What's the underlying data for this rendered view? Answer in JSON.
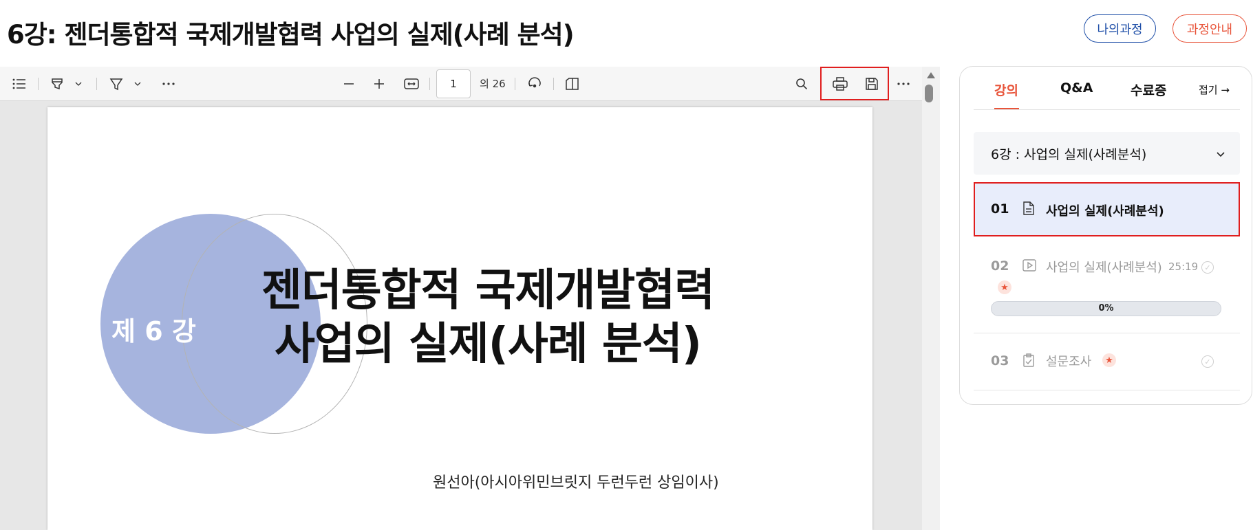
{
  "header": {
    "title": "6강: 젠더통합적 국제개발협력 사업의 실제(사례 분석)",
    "my_course_label": "나의과정",
    "course_guide_label": "과정안내",
    "colors": {
      "primary": "#1f4fa8",
      "accent": "#e8543a",
      "highlight": "#e01e1e"
    }
  },
  "viewer": {
    "toolbar": {
      "icons": [
        "list-icon",
        "highlighter-icon",
        "chevron-down-icon",
        "draw-icon",
        "chevron-down-icon",
        "more-icon",
        "zoom-out-icon",
        "zoom-in-icon",
        "fit-width-icon",
        "rotate-icon",
        "page-view-icon",
        "search-icon",
        "print-icon",
        "save-icon",
        "more-icon"
      ],
      "page_current": "1",
      "page_total_label": "의 26"
    },
    "slide": {
      "lecture_number": "제 6 강",
      "title_line1": "젠더통합적 국제개발협력",
      "title_line2": "사업의 실제(사례 분석)",
      "author": "원선아(아시아위민브릿지 두런두런 상임이사)"
    }
  },
  "panel": {
    "tabs": [
      {
        "label": "강의",
        "active": true
      },
      {
        "label": "Q&A",
        "active": false
      },
      {
        "label": "수료증",
        "active": false
      }
    ],
    "fold_label": "접기 →",
    "chapter_label": "6강 : 사업의 실제(사례분석)",
    "items": [
      {
        "number": "01",
        "icon": "document-icon",
        "title": "사업의 실제(사례분석)",
        "active": true
      },
      {
        "number": "02",
        "icon": "video-icon",
        "title": "사업의 실제(사례분석)",
        "duration": "25:19",
        "progress_label": "0%",
        "progress": 0
      },
      {
        "number": "03",
        "icon": "clipboard-icon",
        "title": "설문조사"
      }
    ]
  }
}
